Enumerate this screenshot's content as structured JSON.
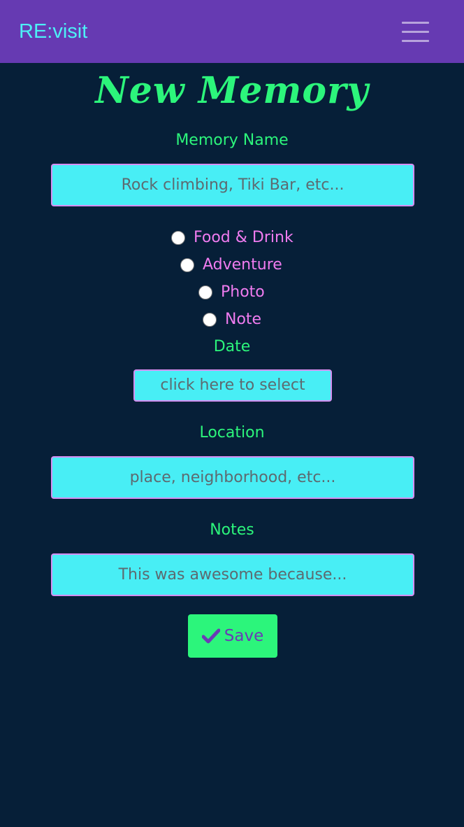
{
  "navbar": {
    "brand": "RE:visit",
    "menu_icon": "hamburger-menu-icon"
  },
  "page_title": "New Memory",
  "memory_name": {
    "label": "Memory Name",
    "placeholder": "Rock climbing, Tiki Bar, etc...",
    "value": ""
  },
  "categories": [
    {
      "label": "Food & Drink",
      "selected": false
    },
    {
      "label": "Adventure",
      "selected": false
    },
    {
      "label": "Photo",
      "selected": false
    },
    {
      "label": "Note",
      "selected": false
    }
  ],
  "date": {
    "label": "Date",
    "button_text": "click here to select"
  },
  "location": {
    "label": "Location",
    "placeholder": "place, neighborhood, etc...",
    "value": ""
  },
  "notes": {
    "label": "Notes",
    "placeholder": "This was awesome because...",
    "value": ""
  },
  "save": {
    "label": "Save",
    "icon": "checkmark-icon"
  },
  "colors": {
    "navbar_bg": "#663ab2",
    "page_bg": "#061f38",
    "brand": "#4df0f6",
    "accent_green": "#2cf57b",
    "input_bg": "#48eef5",
    "radio_label": "#f07cf0"
  }
}
